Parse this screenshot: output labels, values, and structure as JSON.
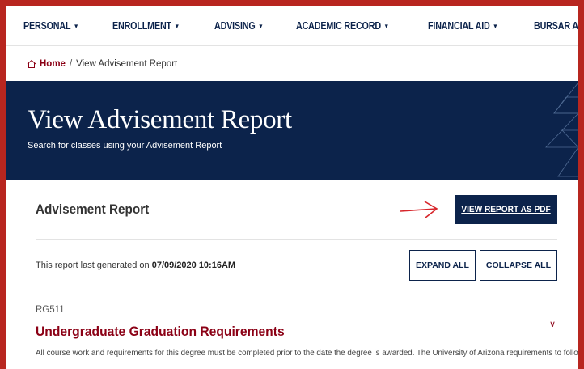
{
  "nav": {
    "items": [
      {
        "label": "PERSONAL"
      },
      {
        "label": "ENROLLMENT"
      },
      {
        "label": "ADVISING"
      },
      {
        "label": "ACADEMIC RECORD"
      },
      {
        "label": "FINANCIAL AID"
      },
      {
        "label": "BURSAR ACCOUNT"
      }
    ],
    "caret": "▼"
  },
  "breadcrumb": {
    "home": "Home",
    "separator": "/",
    "current": "View Advisement Report"
  },
  "banner": {
    "title": "View Advisement Report",
    "subtitle": "Search for classes using your Advisement Report"
  },
  "report": {
    "heading": "Advisement Report",
    "pdf_button": "VIEW REPORT AS PDF",
    "generated_prefix": "This report last generated on ",
    "generated_date": "07/09/2020 10:16AM",
    "expand_all": "EXPAND ALL",
    "collapse_all": "COLLAPSE ALL"
  },
  "requirement": {
    "code": "RG511",
    "title": "Undergraduate Graduation Requirements",
    "chevron": "∨",
    "description": "All course work and requirements for this degree must be completed prior to the date the degree is awarded. The University of Arizona requirements to follow in"
  },
  "colors": {
    "navy": "#0c234b",
    "red": "#8b0015",
    "frame": "#b8261f",
    "arrow": "#d7262b"
  }
}
